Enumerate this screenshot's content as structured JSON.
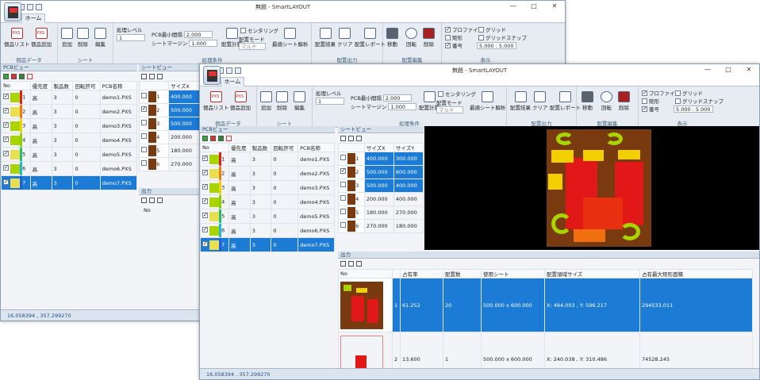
{
  "window": {
    "title": "無題 - SmartLAYOUT",
    "tab_home": "ホーム",
    "controls": [
      "―",
      "□",
      "✕"
    ]
  },
  "ribbon": {
    "parts_data": {
      "label": "個品データ",
      "list": "個品リスト",
      "add": "個品追加"
    },
    "sheet": {
      "label": "シート",
      "add": "追加",
      "delete": "削除",
      "edit": "編集"
    },
    "conditions": {
      "label": "処理条件",
      "level_label": "処理レベル",
      "level_value": "1",
      "min_gap_label": "PCB最小間隔",
      "min_gap_value": "2.000",
      "margin_label": "シートマージン",
      "margin_value": "1.000",
      "calc": "配置計算",
      "centering": "センタリング",
      "mode_label": "配置モード",
      "mode_value": "マルチ",
      "optimal": "最適シート解析"
    },
    "output": {
      "label": "配置出力",
      "result": "配置結果",
      "clear": "クリア",
      "report": "配置レポート"
    },
    "edit": {
      "label": "配置編集",
      "move": "移動",
      "rotate": "回転",
      "delete": "削除"
    },
    "display": {
      "label": "表示",
      "profile": "プロファイル",
      "rect": "矩形",
      "number": "番号",
      "grid": "グリッド",
      "grid_snap": "グリッドスナップ",
      "grid_size": "5.000 : 5.000"
    }
  },
  "pcb_view": {
    "title": "PCBビュー",
    "headers": [
      "No",
      "優先度",
      "製品数",
      "回転許可",
      "PCB名称"
    ],
    "rows": [
      {
        "no": "1",
        "priority": "高",
        "count": "3",
        "rot": "0",
        "name": "demo1.PXS"
      },
      {
        "no": "2",
        "priority": "高",
        "count": "3",
        "rot": "0",
        "name": "demo2.PXS"
      },
      {
        "no": "3",
        "priority": "高",
        "count": "3",
        "rot": "0",
        "name": "demo3.PXS"
      },
      {
        "no": "4",
        "priority": "高",
        "count": "3",
        "rot": "0",
        "name": "demo4.PXS"
      },
      {
        "no": "5",
        "priority": "高",
        "count": "3",
        "rot": "0",
        "name": "demo5.PXS"
      },
      {
        "no": "6",
        "priority": "高",
        "count": "3",
        "rot": "0",
        "name": "demo6.PXS"
      },
      {
        "no": "7",
        "priority": "高",
        "count": "3",
        "rot": "0",
        "name": "demo7.PXS"
      }
    ],
    "bar_colors": [
      "#e02020",
      "#f07a10",
      "#f2d000",
      "#8ad000",
      "#20c070",
      "#20b8d8",
      "#2060e0"
    ]
  },
  "sheet_view": {
    "title": "シートビュー",
    "headers": [
      "No",
      "サイズX",
      "サイズY"
    ],
    "rows": [
      {
        "no": "1",
        "x": "400.000",
        "y": "300.000"
      },
      {
        "no": "2",
        "x": "500.000",
        "y": "600.000"
      },
      {
        "no": "3",
        "x": "500.000",
        "y": "400.000"
      },
      {
        "no": "4",
        "x": "200.000",
        "y": "400.000"
      },
      {
        "no": "5",
        "x": "180.000",
        "y": "270.000"
      },
      {
        "no": "6",
        "x": "270.000",
        "y": "180.000"
      }
    ],
    "back_rows": [
      {
        "no": "1",
        "x": "400.000"
      },
      {
        "no": "2",
        "x": "500.000"
      },
      {
        "no": "3",
        "x": "500.000"
      },
      {
        "no": "4",
        "x": "200.000"
      },
      {
        "no": "5",
        "x": "180.000"
      },
      {
        "no": "6",
        "x": "270.000"
      }
    ]
  },
  "output": {
    "title": "出力",
    "headers": [
      "No",
      "占有率",
      "配置数",
      "使用シート",
      "配置領域サイズ",
      "占有最大矩形面積"
    ],
    "rows": [
      {
        "no": "1",
        "ratio": "61.252",
        "count": "20",
        "sheet": "500.000 x 600.000",
        "area": "X: 494.003 , Y: 596.217",
        "max": "294533.011"
      },
      {
        "no": "2",
        "ratio": "13.600",
        "count": "1",
        "sheet": "500.000 x 600.000",
        "area": "X: 240.038 , Y: 310.486",
        "max": "74528.245"
      }
    ],
    "back_header": "No"
  },
  "status": {
    "coords": "16.058394 , 357.299270"
  }
}
